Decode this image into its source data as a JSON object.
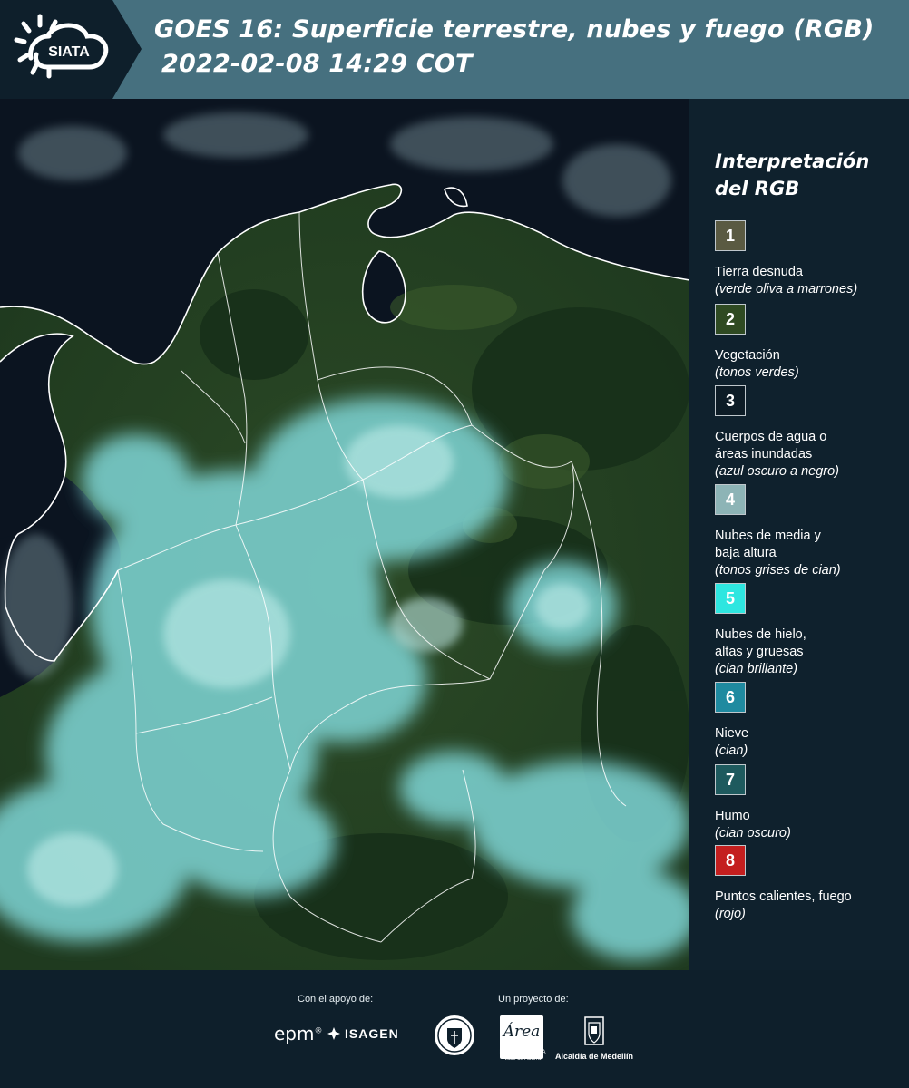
{
  "header": {
    "logo_text": "SIATA",
    "title_line1": "GOES 16: Superficie terrestre, nubes y fuego (RGB)",
    "title_line2": "2022-02-08 14:29 COT",
    "bg_color": "#46707f",
    "logo_block_color": "#0e1f2b"
  },
  "legend": {
    "title_line1": "Interpretación",
    "title_line2": "del RGB",
    "items": [
      {
        "number": "1",
        "label_lines": [
          "Tierra desnuda"
        ],
        "sub": "(verde oliva a marrones)",
        "color": "#5a5a42"
      },
      {
        "number": "2",
        "label_lines": [
          "Vegetación"
        ],
        "sub": "(tonos verdes)",
        "color": "#2f4a22"
      },
      {
        "number": "3",
        "label_lines": [
          "Cuerpos de agua o",
          "áreas inundadas"
        ],
        "sub": "(azul oscuro a negro)",
        "color": "#0d1c26"
      },
      {
        "number": "4",
        "label_lines": [
          "Nubes de media y",
          "baja altura"
        ],
        "sub": "(tonos grises de cian)",
        "color": "#8db4b6"
      },
      {
        "number": "5",
        "label_lines": [
          "Nubes de hielo,",
          "altas y gruesas"
        ],
        "sub": "(cian brillante)",
        "color": "#2ee6e0"
      },
      {
        "number": "6",
        "label_lines": [
          "Nieve"
        ],
        "sub": "(cian)",
        "color": "#1f8aa0"
      },
      {
        "number": "7",
        "label_lines": [
          "Humo"
        ],
        "sub": "(cian oscuro)",
        "color": "#1e5a5e"
      },
      {
        "number": "8",
        "label_lines": [
          "Puntos calientes, fuego"
        ],
        "sub": "(rojo)",
        "color": "#c41f1f"
      }
    ]
  },
  "footer": {
    "support_label": "Con el apoyo de:",
    "project_label": "Un proyecto de:",
    "epm": "epm",
    "isagen": "ISAGEN",
    "area_logo": "Área",
    "area_sub": "METROPOLITANA Valle de Aburrá",
    "medellin": "Alcaldía de Medellín"
  }
}
